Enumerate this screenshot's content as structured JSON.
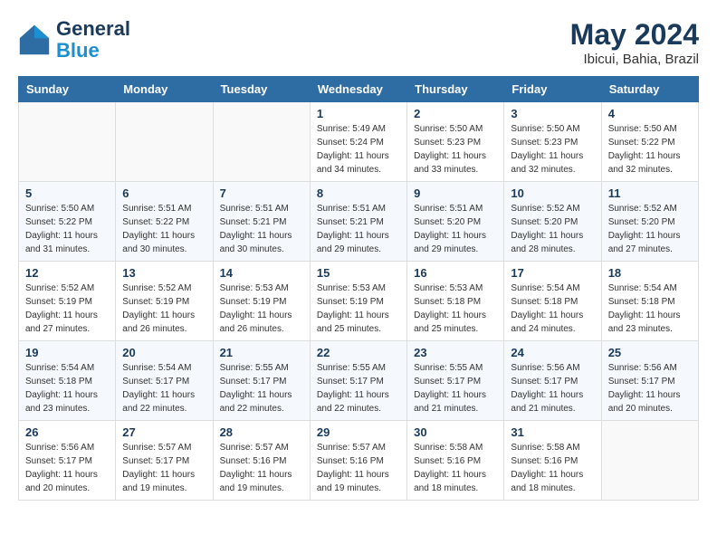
{
  "header": {
    "logo": {
      "line1": "General",
      "line2": "Blue"
    },
    "title": "May 2024",
    "location": "Ibicui, Bahia, Brazil"
  },
  "weekdays": [
    "Sunday",
    "Monday",
    "Tuesday",
    "Wednesday",
    "Thursday",
    "Friday",
    "Saturday"
  ],
  "weeks": [
    [
      {
        "day": "",
        "sunrise": "",
        "sunset": "",
        "daylight": ""
      },
      {
        "day": "",
        "sunrise": "",
        "sunset": "",
        "daylight": ""
      },
      {
        "day": "",
        "sunrise": "",
        "sunset": "",
        "daylight": ""
      },
      {
        "day": "1",
        "sunrise": "Sunrise: 5:49 AM",
        "sunset": "Sunset: 5:24 PM",
        "daylight": "Daylight: 11 hours and 34 minutes."
      },
      {
        "day": "2",
        "sunrise": "Sunrise: 5:50 AM",
        "sunset": "Sunset: 5:23 PM",
        "daylight": "Daylight: 11 hours and 33 minutes."
      },
      {
        "day": "3",
        "sunrise": "Sunrise: 5:50 AM",
        "sunset": "Sunset: 5:23 PM",
        "daylight": "Daylight: 11 hours and 32 minutes."
      },
      {
        "day": "4",
        "sunrise": "Sunrise: 5:50 AM",
        "sunset": "Sunset: 5:22 PM",
        "daylight": "Daylight: 11 hours and 32 minutes."
      }
    ],
    [
      {
        "day": "5",
        "sunrise": "Sunrise: 5:50 AM",
        "sunset": "Sunset: 5:22 PM",
        "daylight": "Daylight: 11 hours and 31 minutes."
      },
      {
        "day": "6",
        "sunrise": "Sunrise: 5:51 AM",
        "sunset": "Sunset: 5:22 PM",
        "daylight": "Daylight: 11 hours and 30 minutes."
      },
      {
        "day": "7",
        "sunrise": "Sunrise: 5:51 AM",
        "sunset": "Sunset: 5:21 PM",
        "daylight": "Daylight: 11 hours and 30 minutes."
      },
      {
        "day": "8",
        "sunrise": "Sunrise: 5:51 AM",
        "sunset": "Sunset: 5:21 PM",
        "daylight": "Daylight: 11 hours and 29 minutes."
      },
      {
        "day": "9",
        "sunrise": "Sunrise: 5:51 AM",
        "sunset": "Sunset: 5:20 PM",
        "daylight": "Daylight: 11 hours and 29 minutes."
      },
      {
        "day": "10",
        "sunrise": "Sunrise: 5:52 AM",
        "sunset": "Sunset: 5:20 PM",
        "daylight": "Daylight: 11 hours and 28 minutes."
      },
      {
        "day": "11",
        "sunrise": "Sunrise: 5:52 AM",
        "sunset": "Sunset: 5:20 PM",
        "daylight": "Daylight: 11 hours and 27 minutes."
      }
    ],
    [
      {
        "day": "12",
        "sunrise": "Sunrise: 5:52 AM",
        "sunset": "Sunset: 5:19 PM",
        "daylight": "Daylight: 11 hours and 27 minutes."
      },
      {
        "day": "13",
        "sunrise": "Sunrise: 5:52 AM",
        "sunset": "Sunset: 5:19 PM",
        "daylight": "Daylight: 11 hours and 26 minutes."
      },
      {
        "day": "14",
        "sunrise": "Sunrise: 5:53 AM",
        "sunset": "Sunset: 5:19 PM",
        "daylight": "Daylight: 11 hours and 26 minutes."
      },
      {
        "day": "15",
        "sunrise": "Sunrise: 5:53 AM",
        "sunset": "Sunset: 5:19 PM",
        "daylight": "Daylight: 11 hours and 25 minutes."
      },
      {
        "day": "16",
        "sunrise": "Sunrise: 5:53 AM",
        "sunset": "Sunset: 5:18 PM",
        "daylight": "Daylight: 11 hours and 25 minutes."
      },
      {
        "day": "17",
        "sunrise": "Sunrise: 5:54 AM",
        "sunset": "Sunset: 5:18 PM",
        "daylight": "Daylight: 11 hours and 24 minutes."
      },
      {
        "day": "18",
        "sunrise": "Sunrise: 5:54 AM",
        "sunset": "Sunset: 5:18 PM",
        "daylight": "Daylight: 11 hours and 23 minutes."
      }
    ],
    [
      {
        "day": "19",
        "sunrise": "Sunrise: 5:54 AM",
        "sunset": "Sunset: 5:18 PM",
        "daylight": "Daylight: 11 hours and 23 minutes."
      },
      {
        "day": "20",
        "sunrise": "Sunrise: 5:54 AM",
        "sunset": "Sunset: 5:17 PM",
        "daylight": "Daylight: 11 hours and 22 minutes."
      },
      {
        "day": "21",
        "sunrise": "Sunrise: 5:55 AM",
        "sunset": "Sunset: 5:17 PM",
        "daylight": "Daylight: 11 hours and 22 minutes."
      },
      {
        "day": "22",
        "sunrise": "Sunrise: 5:55 AM",
        "sunset": "Sunset: 5:17 PM",
        "daylight": "Daylight: 11 hours and 22 minutes."
      },
      {
        "day": "23",
        "sunrise": "Sunrise: 5:55 AM",
        "sunset": "Sunset: 5:17 PM",
        "daylight": "Daylight: 11 hours and 21 minutes."
      },
      {
        "day": "24",
        "sunrise": "Sunrise: 5:56 AM",
        "sunset": "Sunset: 5:17 PM",
        "daylight": "Daylight: 11 hours and 21 minutes."
      },
      {
        "day": "25",
        "sunrise": "Sunrise: 5:56 AM",
        "sunset": "Sunset: 5:17 PM",
        "daylight": "Daylight: 11 hours and 20 minutes."
      }
    ],
    [
      {
        "day": "26",
        "sunrise": "Sunrise: 5:56 AM",
        "sunset": "Sunset: 5:17 PM",
        "daylight": "Daylight: 11 hours and 20 minutes."
      },
      {
        "day": "27",
        "sunrise": "Sunrise: 5:57 AM",
        "sunset": "Sunset: 5:17 PM",
        "daylight": "Daylight: 11 hours and 19 minutes."
      },
      {
        "day": "28",
        "sunrise": "Sunrise: 5:57 AM",
        "sunset": "Sunset: 5:16 PM",
        "daylight": "Daylight: 11 hours and 19 minutes."
      },
      {
        "day": "29",
        "sunrise": "Sunrise: 5:57 AM",
        "sunset": "Sunset: 5:16 PM",
        "daylight": "Daylight: 11 hours and 19 minutes."
      },
      {
        "day": "30",
        "sunrise": "Sunrise: 5:58 AM",
        "sunset": "Sunset: 5:16 PM",
        "daylight": "Daylight: 11 hours and 18 minutes."
      },
      {
        "day": "31",
        "sunrise": "Sunrise: 5:58 AM",
        "sunset": "Sunset: 5:16 PM",
        "daylight": "Daylight: 11 hours and 18 minutes."
      },
      {
        "day": "",
        "sunrise": "",
        "sunset": "",
        "daylight": ""
      }
    ]
  ]
}
